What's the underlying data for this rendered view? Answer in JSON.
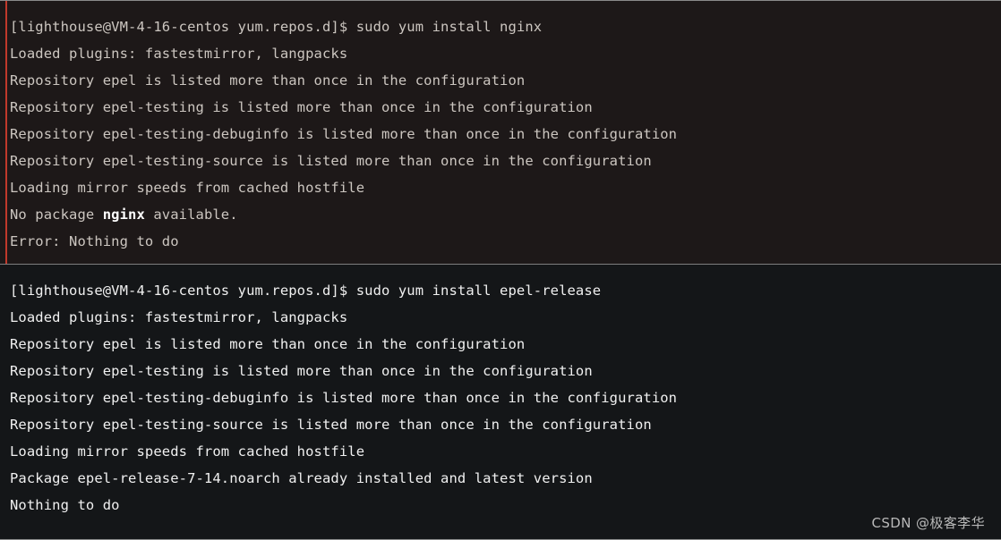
{
  "terminal": {
    "accent_color": "#c0392b",
    "blocks": [
      {
        "name": "nginx-install-attempt",
        "background": "#1d1818",
        "text_color": "#ccc6c0",
        "has_accent_bar": true,
        "lines": [
          {
            "text": "[lighthouse@VM-4-16-centos yum.repos.d]$ sudo yum install nginx"
          },
          {
            "text": "Loaded plugins: fastestmirror, langpacks"
          },
          {
            "text": "Repository epel is listed more than once in the configuration"
          },
          {
            "text": "Repository epel-testing is listed more than once in the configuration"
          },
          {
            "text": "Repository epel-testing-debuginfo is listed more than once in the configuration"
          },
          {
            "text": "Repository epel-testing-source is listed more than once in the configuration"
          },
          {
            "text": "Loading mirror speeds from cached hostfile"
          },
          {
            "text": "No package ",
            "strong": "nginx",
            "text_after": " available."
          },
          {
            "text": "Error: Nothing to do"
          }
        ]
      },
      {
        "name": "epel-release-install-attempt",
        "background": "#141618",
        "text_color": "#f0f0f0",
        "has_accent_bar": false,
        "lines": [
          {
            "text": "[lighthouse@VM-4-16-centos yum.repos.d]$ sudo yum install epel-release"
          },
          {
            "text": "Loaded plugins: fastestmirror, langpacks"
          },
          {
            "text": "Repository epel is listed more than once in the configuration"
          },
          {
            "text": "Repository epel-testing is listed more than once in the configuration"
          },
          {
            "text": "Repository epel-testing-debuginfo is listed more than once in the configuration"
          },
          {
            "text": "Repository epel-testing-source is listed more than once in the configuration"
          },
          {
            "text": "Loading mirror speeds from cached hostfile"
          },
          {
            "text": "Package epel-release-7-14.noarch already installed and latest version"
          },
          {
            "text": "Nothing to do"
          }
        ]
      }
    ]
  },
  "watermark": {
    "text": "CSDN @极客李华"
  }
}
